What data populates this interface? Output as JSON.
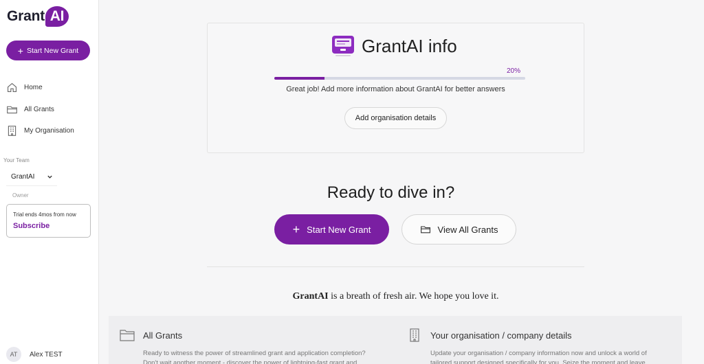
{
  "app": {
    "logo_main": "Grant",
    "logo_accent": "AI"
  },
  "sidebar": {
    "start_label": "Start New Grant",
    "items": [
      {
        "label": "Home",
        "icon": "home-icon"
      },
      {
        "label": "All Grants",
        "icon": "folder-icon"
      },
      {
        "label": "My Organisation",
        "icon": "building-icon"
      }
    ],
    "team_label": "Your Team",
    "team_value": "GrantAI",
    "role": "Owner",
    "trial_text": "Trial ends 4mos from now",
    "subscribe_label": "Subscribe",
    "user_initials": "AT",
    "user_name": "Alex TEST"
  },
  "info": {
    "title": "GrantAI info",
    "progress_percent": 20,
    "progress_label": "20%",
    "message": "Great job! Add more information about GrantAI for better answers",
    "button_label": "Add organisation details"
  },
  "hero": {
    "headline": "Ready to dive in?",
    "start_label": "Start New Grant",
    "view_label": "View All Grants"
  },
  "tagline": {
    "brand": "GrantAI",
    "rest": " is a breath of fresh air. We hope you love it."
  },
  "features": {
    "left": {
      "title": "All Grants",
      "text": "Ready to witness the power of streamlined grant and application completion? Don't wait another moment - discover the power of lightning-fast grant and"
    },
    "right": {
      "title": "Your organisation / company details",
      "text": "Update your organisation / company information now and unlock a world of tailored support designed specifically for you. Seize the moment and leave"
    }
  },
  "colors": {
    "accent": "#7a1fa2",
    "progress_track": "#d5d8e4"
  }
}
